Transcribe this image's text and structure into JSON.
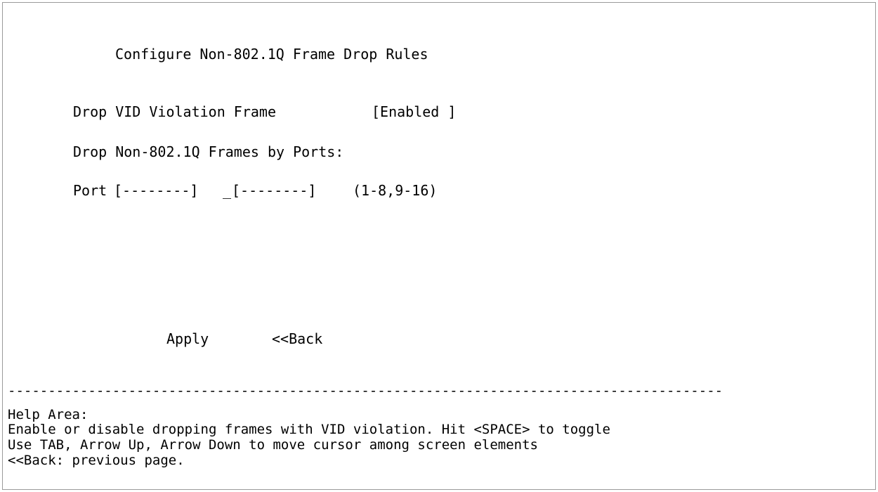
{
  "screen": {
    "title": "Configure Non-802.1Q Frame Drop Rules",
    "drop_vid": {
      "label": "Drop VID Violation Frame",
      "value": "[Enabled ]"
    },
    "drop_ports_label": "Drop Non-802.1Q Frames by Ports:",
    "port": {
      "label": "Port",
      "group1": "[--------]",
      "separator": "_",
      "group2": "[--------]",
      "range": "(1-8,9-16)"
    },
    "buttons": {
      "apply": "Apply",
      "back": "<<Back"
    }
  },
  "divider": "-----------------------------------------------------------------------------------------",
  "help": {
    "heading": "Help Area:",
    "lines": [
      "Enable or disable dropping frames with VID violation. Hit <SPACE> to toggle",
      "Use TAB, Arrow Up, Arrow Down to move cursor among screen elements",
      "<<Back: previous page."
    ]
  }
}
